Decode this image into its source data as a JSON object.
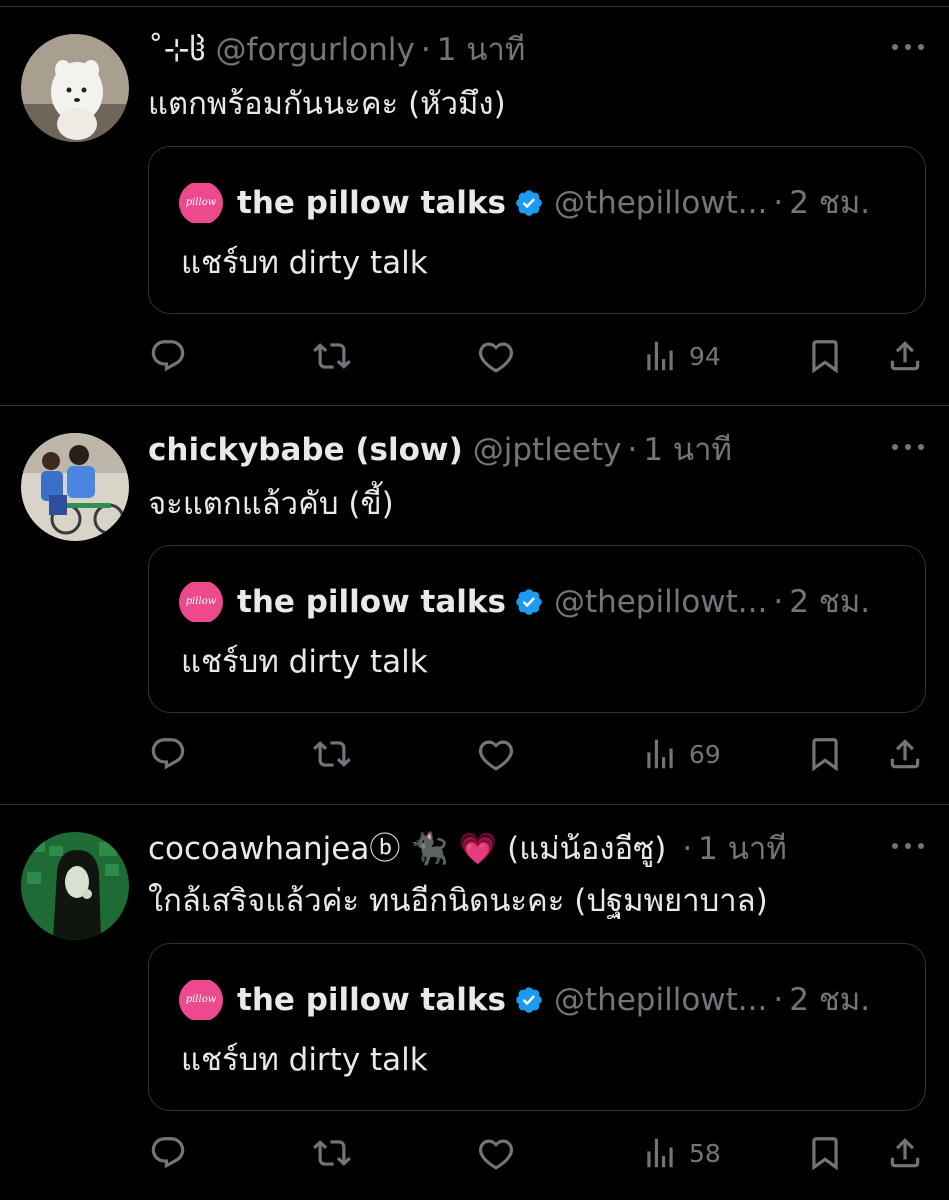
{
  "posts": [
    {
      "display_name": "˚⊹ჱ",
      "handle": "@forgurlonly",
      "separator": "·",
      "time": "1 นาที",
      "text": "แตกพร้อมกันนะคะ (หัวมึง)",
      "views": "94",
      "avatar": "white-puppy-avatar"
    },
    {
      "display_name": "chickybabe (slow)",
      "handle": "@jptleety",
      "separator": "·",
      "time": "1 นาที",
      "text": "จะแตกแล้วคับ (ขี้)",
      "views": "69",
      "avatar": "kids-on-bike-avatar"
    },
    {
      "display_name": "cocoawhanjeaⓑ 🐈‍⬛ 💗 (แม่น้องอีซู)",
      "handle": "",
      "separator": "·",
      "time": "1 นาที",
      "text": "ใกล้เสริจแล้วค่ะ ทนอีกนิดนะคะ (ปฐมพยาบาล)",
      "views": "58",
      "avatar": "green-room-selfie-avatar"
    }
  ],
  "quote": {
    "name": "the pillow talks",
    "handle": "@thepillowt...",
    "separator": "·",
    "time": "2 ชม.",
    "text": "แชร์บท dirty talk",
    "avatar_text": "pillow"
  },
  "colors": {
    "background": "#000000",
    "text": "#e7e9ea",
    "secondary": "#71767b",
    "border": "#2f3336",
    "verified": "#1d9bf0",
    "brand_pink": "#ec4a8c"
  },
  "icons": [
    "reply-icon",
    "repost-icon",
    "like-icon",
    "views-icon",
    "bookmark-icon",
    "share-icon",
    "more-icon",
    "verified-icon"
  ]
}
